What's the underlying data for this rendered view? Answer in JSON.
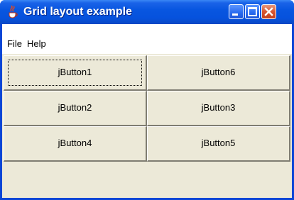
{
  "window": {
    "title": "Grid layout example",
    "icon": "java-cup-icon",
    "controls": [
      "minimize-icon",
      "maximize-icon",
      "close-icon"
    ]
  },
  "menubar": {
    "items": [
      {
        "label": "File"
      },
      {
        "label": "Help"
      }
    ]
  },
  "grid": {
    "buttons": [
      {
        "label": "jButton1",
        "focused": true
      },
      {
        "label": "jButton6"
      },
      {
        "label": "jButton2"
      },
      {
        "label": "jButton3"
      },
      {
        "label": "jButton4"
      },
      {
        "label": "jButton5"
      }
    ]
  },
  "colors": {
    "titlebar": "#0652dd",
    "client_background": "#ece9d8",
    "close_button": "#d9552f"
  }
}
